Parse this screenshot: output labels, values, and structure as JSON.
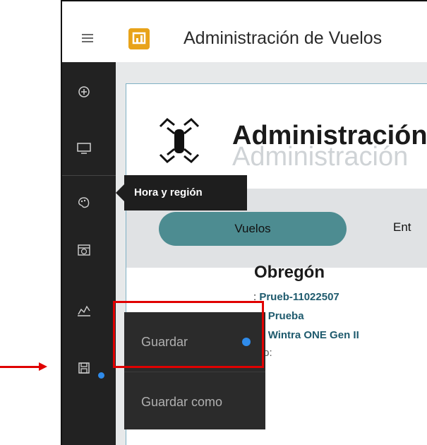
{
  "app": {
    "title": "Administración de Vuelos"
  },
  "panel": {
    "heading": "Administración",
    "heading_shadow": "Administración"
  },
  "tabs": {
    "active": "Vuelos",
    "next_partial": "Ent"
  },
  "detail": {
    "title_partial": "Obregón",
    "line1_suffix": ": ",
    "line1_value": "Prueb-11022507",
    "line2_suffix": "o: ",
    "line2_value": "Prueba",
    "line3_suffix": "o: ",
    "line3_value": "Wintra ONE Gen II",
    "line4_partial": "Piloto:"
  },
  "tooltip": {
    "label": "Hora y región"
  },
  "menu": {
    "save": "Guardar",
    "save_as": "Guardar como"
  },
  "colors": {
    "highlight": "#e00000",
    "accent": "#2f8bea",
    "tab_active": "#4d8c91",
    "sidebar": "#222222"
  },
  "icons": {
    "menu": "hamburger-icon",
    "logo": "app-logo-icon",
    "add": "plus-circle-icon",
    "monitor": "monitor-icon",
    "palette": "palette-icon",
    "datetime": "calendar-globe-icon",
    "chart": "chart-line-icon",
    "save": "save-icon",
    "drone": "drone-icon"
  }
}
